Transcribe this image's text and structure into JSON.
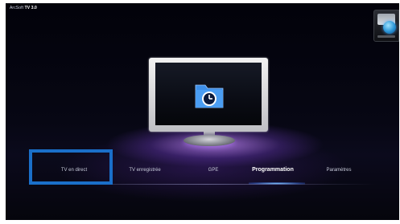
{
  "app": {
    "title_prefix": "ArcSoft",
    "title_product": "TV 3.0"
  },
  "gadget": {
    "icon": "media-center-gadget-icon"
  },
  "tv_display": {
    "icon": "folder-clock-icon",
    "colors": {
      "folder": "#3d8fe8",
      "clock_face": "#0c1a3a"
    }
  },
  "menu": {
    "items": [
      {
        "label": "TV en direct",
        "active": false
      },
      {
        "label": "TV enregistrée",
        "active": false
      },
      {
        "label": "GPE",
        "active": false
      },
      {
        "label": "Programmation",
        "active": true
      },
      {
        "label": "Paramètres",
        "active": false
      }
    ]
  },
  "colors": {
    "accent": "#1a6fc9",
    "glow": "#b07cff",
    "background": "#05050c"
  }
}
